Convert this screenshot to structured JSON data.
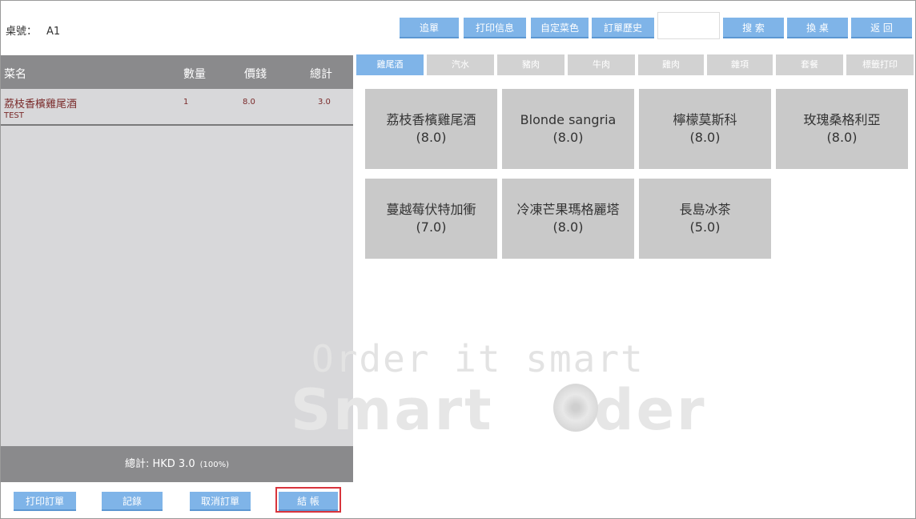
{
  "header": {
    "table_label": "桌號：",
    "table_number": "A1",
    "buttons": {
      "add_order": "追單",
      "print_info": "打印信息",
      "custom_color": "自定菜色",
      "order_history": "訂單歷史",
      "search": "搜 索",
      "change_table": "換 桌",
      "back": "返 回"
    },
    "search_value": ""
  },
  "order_list": {
    "columns": {
      "name": "菜名",
      "qty": "數量",
      "price": "價錢",
      "total": "總計"
    },
    "rows": [
      {
        "name": "荔枝香檳雞尾酒",
        "note": "TEST",
        "qty": "1",
        "price": "8.0",
        "total": "3.0"
      }
    ],
    "total_label": "總計: HKD 3.0",
    "total_pct": "(100%)"
  },
  "footer_buttons": {
    "print_order": "打印訂單",
    "records": "記錄",
    "cancel_order": "取消訂單",
    "checkout": "結 帳"
  },
  "categories": [
    "雞尾酒",
    "汽水",
    "豬肉",
    "牛肉",
    "雞肉",
    "雜項",
    "套餐",
    "標籤打印"
  ],
  "active_category": "雞尾酒",
  "items": [
    {
      "name": "荔枝香檳雞尾酒",
      "price": "(8.0)"
    },
    {
      "name": "Blonde sangria",
      "price": "(8.0)"
    },
    {
      "name": "檸檬莫斯科",
      "price": "(8.0)"
    },
    {
      "name": "玫瑰桑格利亞",
      "price": "(8.0)"
    },
    {
      "name": "蔓越莓伏特加衝",
      "price": "(7.0)"
    },
    {
      "name": "冷凍芒果瑪格麗塔",
      "price": "(8.0)"
    },
    {
      "name": "長島冰茶",
      "price": "(5.0)"
    }
  ],
  "watermark": {
    "line1": "Order it smart",
    "line2_left": "Smart ",
    "line2_right": "rder"
  },
  "colors": {
    "accent_button": "#7fb4e8",
    "header_gray": "#8a8a8c",
    "panel_gray": "#d8d8da",
    "card_gray": "#c9c9c9",
    "checkout_outline": "#d8343c",
    "order_text": "#7a2a2a"
  }
}
